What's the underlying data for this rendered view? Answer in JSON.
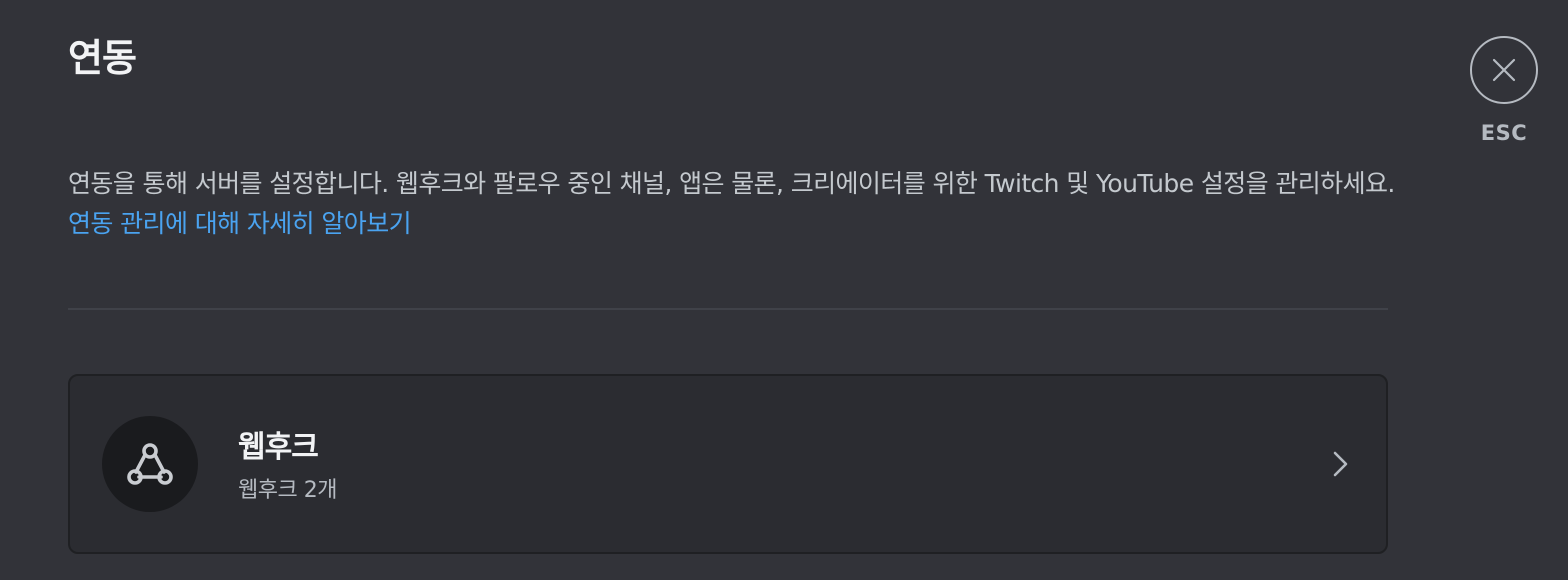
{
  "header": {
    "title": "연동",
    "close_label": "ESC"
  },
  "description": {
    "text": "연동을 통해 서버를 설정합니다. 웹후크와 팔로우 중인 채널, 앱은 물론, 크리에이터를 위한 Twitch 및 YouTube 설정을 관리하세요. ",
    "link_text": "연동 관리에 대해 자세히 알아보기"
  },
  "integrations": [
    {
      "title": "웹후크",
      "subtitle": "웹후크 2개",
      "icon": "webhook-icon"
    }
  ],
  "colors": {
    "background": "#323339",
    "card": "#2b2c31",
    "link": "#4aa3f0",
    "icon_bg": "#1a1b1e"
  }
}
